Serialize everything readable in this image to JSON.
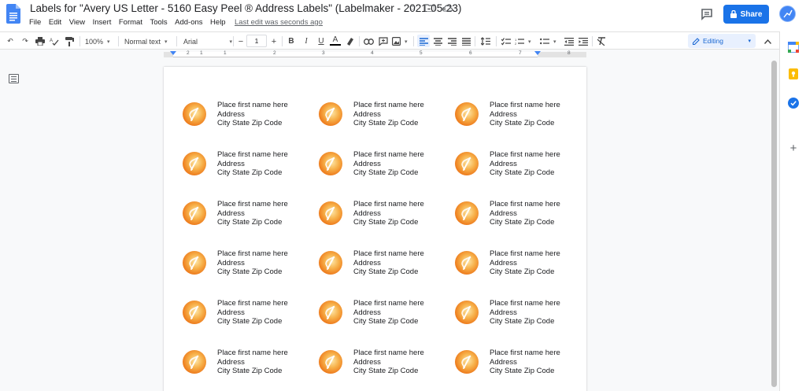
{
  "title": {
    "doc_title": "Labels for \"Avery US Letter - 5160 Easy Peel ® Address Labels\" (Labelmaker - 2021-05-23)",
    "last_edit": "Last edit was seconds ago",
    "share_label": "Share"
  },
  "menu": [
    "File",
    "Edit",
    "View",
    "Insert",
    "Format",
    "Tools",
    "Add-ons",
    "Help"
  ],
  "toolbar": {
    "zoom": "100%",
    "style": "Normal text",
    "font": "Arial",
    "font_size": "1",
    "minus": "−",
    "plus": "+",
    "bold": "B",
    "italic": "I",
    "underline": "U",
    "text_color": "A",
    "editing_mode": "Editing"
  },
  "ruler": {
    "numbers": [
      "2",
      "1",
      "1",
      "2",
      "3",
      "4",
      "5",
      "6",
      "7",
      "8"
    ]
  },
  "labels": {
    "line1": "Place first name here",
    "line2": "Address",
    "line3": "City State Zip Code",
    "rows": 6,
    "columns": 3
  },
  "colors": {
    "share_blue": "#1a73e8",
    "accent": "#4285f4",
    "logo_orange": "#ee7d1e"
  }
}
